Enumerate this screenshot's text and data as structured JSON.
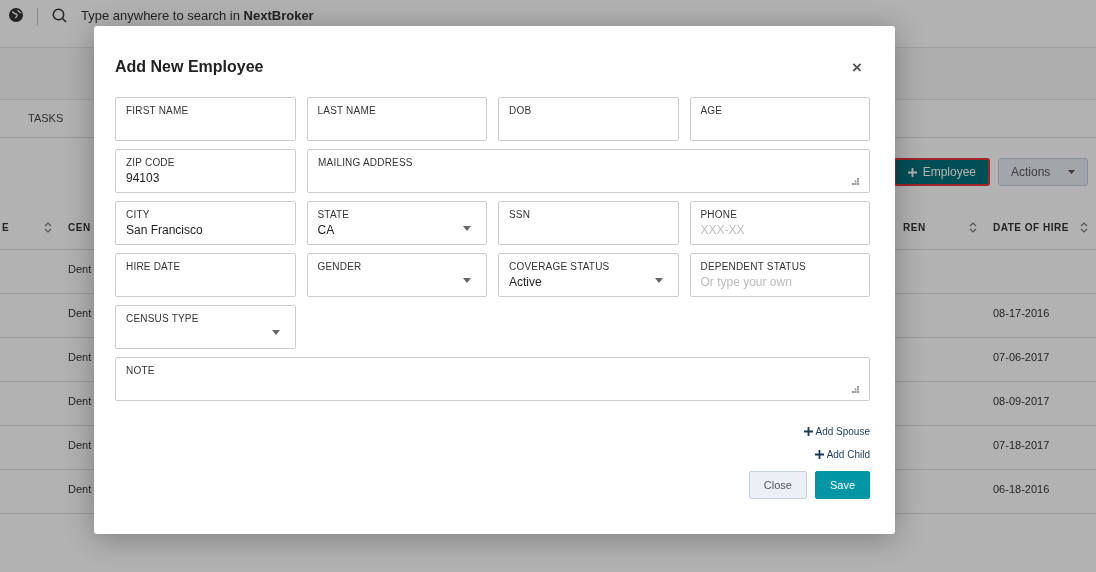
{
  "topbar": {
    "search_placeholder": "Type anywhere to search in **NextBroker**"
  },
  "tabs": [
    {
      "label": "TASKS",
      "selected": false
    }
  ],
  "toolbar": {
    "buttons": [
      {
        "label": "Employee",
        "kind": "primary",
        "highlighted": true
      },
      {
        "label": "Actions",
        "kind": "dropdown",
        "highlighted": false
      }
    ]
  },
  "table": {
    "columns": [
      {
        "label": "E",
        "sortable": true
      },
      {
        "label": "CEN"
      },
      {
        "label": "REN",
        "sortable": true
      },
      {
        "label": "DATE OF HIRE",
        "sortable": true
      }
    ],
    "rows": [
      {
        "column_2": "Dent",
        "date_of_hire": ""
      },
      {
        "column_2": "Dent",
        "date_of_hire": "08-17-2016"
      },
      {
        "column_2": "Dent",
        "date_of_hire": "07-06-2017"
      },
      {
        "column_2": "Dent",
        "date_of_hire": "08-09-2017"
      },
      {
        "column_2": "Dent",
        "date_of_hire": "07-18-2017"
      },
      {
        "column_2": "Dent",
        "date_of_hire": "06-18-2016"
      }
    ]
  },
  "dialog": {
    "title": "Add New Employee",
    "close": "×",
    "rows": [
      [
        {
          "label": "FIRST NAME",
          "kind": "text"
        },
        {
          "label": "LAST NAME",
          "kind": "text"
        },
        {
          "label": "DOB",
          "kind": "text"
        },
        {
          "label": "AGE",
          "kind": "text"
        }
      ],
      [
        {
          "label": "ZIP CODE",
          "kind": "text",
          "value": "94103"
        },
        {
          "label": "MAILING ADDRESS",
          "kind": "textarea"
        }
      ],
      [
        {
          "label": "CITY",
          "kind": "text",
          "value": "San Francisco"
        },
        {
          "label": "STATE",
          "kind": "select",
          "value": "CA"
        },
        {
          "label": "SSN",
          "kind": "text"
        },
        {
          "label": "PHONE",
          "kind": "text",
          "placeholder": "XXX-XX"
        }
      ],
      [
        {
          "label": "HIRE DATE",
          "kind": "text"
        },
        {
          "label": "GENDER",
          "kind": "select"
        },
        {
          "label": "COVERAGE STATUS",
          "kind": "select",
          "value": "Active"
        },
        {
          "label": "DEPENDENT STATUS",
          "kind": "text",
          "placeholder": "Or type your own"
        }
      ],
      [
        {
          "label": "CENSUS TYPE",
          "kind": "select"
        }
      ],
      [
        {
          "label": "NOTE",
          "kind": "textarea"
        }
      ]
    ],
    "links": [
      "Add Spouse",
      "Add Child"
    ],
    "buttons": [
      {
        "label": "Close",
        "kind": "secondary"
      },
      {
        "label": "Save",
        "kind": "primary"
      }
    ]
  }
}
